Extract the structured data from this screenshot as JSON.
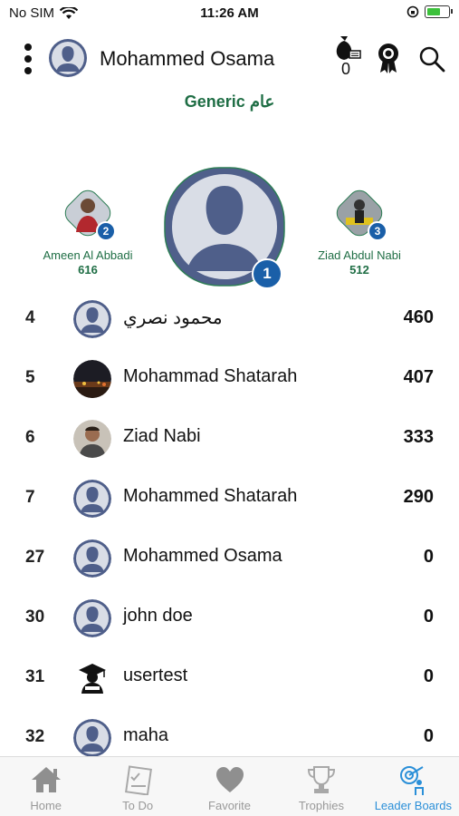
{
  "status_bar": {
    "carrier": "No SIM",
    "time": "11:26 AM"
  },
  "header": {
    "username": "Mohammed Osama",
    "coins_count": "0",
    "subtitle": "Generic عام"
  },
  "podium": {
    "first": {
      "rank": "1"
    },
    "second": {
      "rank": "2",
      "name": "Ameen Al Abbadi",
      "score": "616"
    },
    "third": {
      "rank": "3",
      "name": "Ziad Abdul Nabi",
      "score": "512"
    }
  },
  "leaderboard": [
    {
      "rank": "4",
      "name": "محمود نصري",
      "score": "460",
      "avatar": "default-avatar"
    },
    {
      "rank": "5",
      "name": "Mohammad Shatarah",
      "score": "407",
      "avatar": "photo-night-city"
    },
    {
      "rank": "6",
      "name": "Ziad Nabi",
      "score": "333",
      "avatar": "photo-man"
    },
    {
      "rank": "7",
      "name": "Mohammed Shatarah",
      "score": "290",
      "avatar": "default-avatar"
    },
    {
      "rank": "27",
      "name": "Mohammed Osama",
      "score": "0",
      "avatar": "default-avatar"
    },
    {
      "rank": "30",
      "name": "john doe",
      "score": "0",
      "avatar": "default-avatar"
    },
    {
      "rank": "31",
      "name": "usertest",
      "score": "0",
      "avatar": "graduate-icon"
    },
    {
      "rank": "32",
      "name": "maha",
      "score": "0",
      "avatar": "default-avatar"
    }
  ],
  "tabs": [
    {
      "label": "Home",
      "icon": "home-icon"
    },
    {
      "label": "To Do",
      "icon": "todo-icon"
    },
    {
      "label": "Favorite",
      "icon": "heart-icon"
    },
    {
      "label": "Trophies",
      "icon": "trophy-icon"
    },
    {
      "label": "Leader Boards",
      "icon": "leaderboard-icon",
      "active": true
    }
  ],
  "colors": {
    "accent_green": "#1f6e45",
    "rank_blue": "#1a5fa8",
    "active_tab": "#2a8fd8",
    "avatar_bg": "#4f5f8a"
  }
}
